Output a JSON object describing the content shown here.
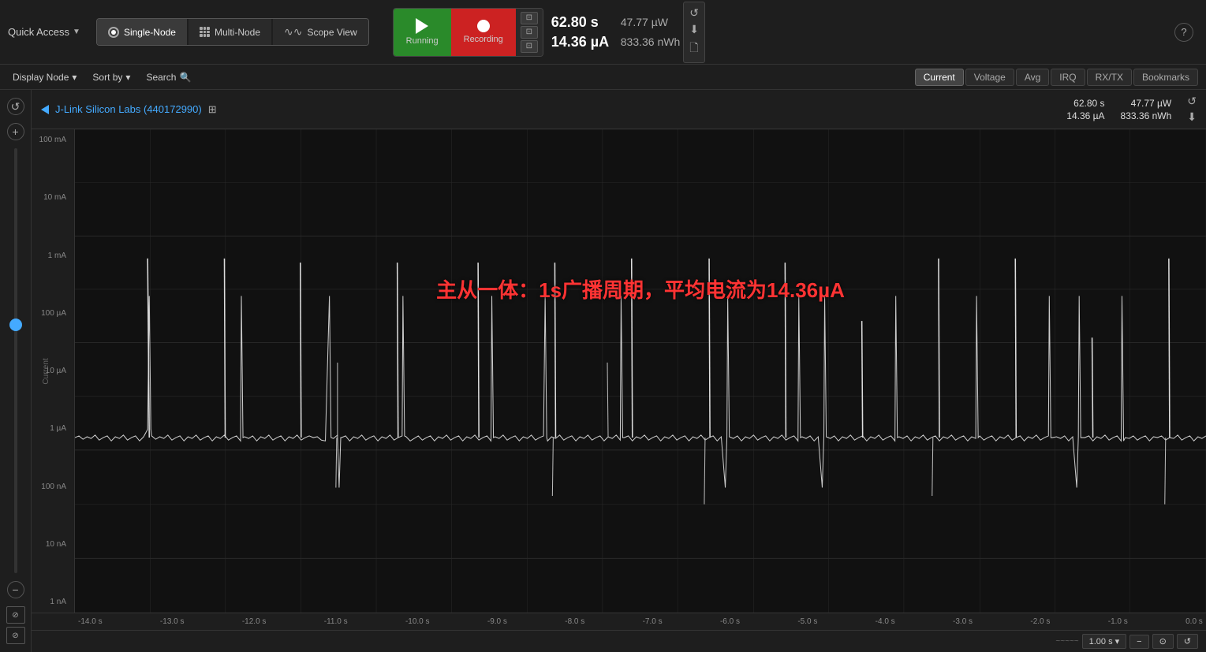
{
  "toolbar": {
    "quick_access_label": "Quick Access",
    "mode_single": "Single-Node",
    "mode_multi": "Multi-Node",
    "mode_scope": "Scope View",
    "btn_running": "Running",
    "btn_recording": "Recording",
    "stat1_time": "62.80 s",
    "stat1_power": "47.77 µW",
    "stat2_current": "14.36 µA",
    "stat2_energy": "833.36 nWh"
  },
  "second_toolbar": {
    "display_node": "Display Node",
    "sort_by": "Sort by",
    "search": "Search"
  },
  "tabs": {
    "current": "Current",
    "voltage": "Voltage",
    "avg": "Avg",
    "irq": "IRQ",
    "rxtx": "RX/TX",
    "bookmarks": "Bookmarks"
  },
  "chart": {
    "device_name": "J-Link Silicon Labs (440172990)",
    "stat_time1": "62.80 s",
    "stat_power1": "47.77 µW",
    "stat_current1": "14.36 µA",
    "stat_energy1": "833.36 nWh",
    "annotation": "主从一体：1s广播周期，平均电流为14.36µA",
    "y_labels": [
      "100 mA",
      "10 mA",
      "1 mA",
      "100 µA",
      "10 µA",
      "1 µA",
      "100 nA",
      "10 nA",
      "1 nA"
    ],
    "x_labels": [
      "-14.0 s",
      "-13.0 s",
      "-12.0 s",
      "-11.0 s",
      "-10.0 s",
      "-9.0 s",
      "-8.0 s",
      "-7.0 s",
      "-6.0 s",
      "-5.0 s",
      "-4.0 s",
      "-3.0 s",
      "-2.0 s",
      "-1.0 s",
      "0.0 s"
    ],
    "y_axis_title": "Current",
    "bottom_time": "1.00 s"
  }
}
